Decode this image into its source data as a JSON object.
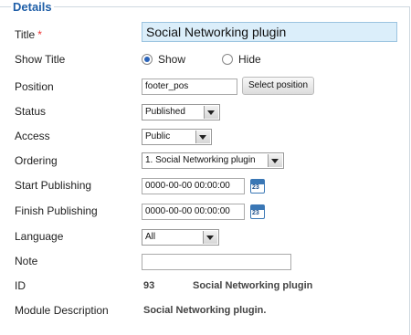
{
  "fieldset": {
    "legend": "Details"
  },
  "title": {
    "label": "Title",
    "required_mark": "*",
    "value": "Social Networking plugin"
  },
  "show_title": {
    "label": "Show Title",
    "options": [
      "Show",
      "Hide"
    ],
    "selected": "Show"
  },
  "position": {
    "label": "Position",
    "value": "footer_pos",
    "button_label": "Select position"
  },
  "status": {
    "label": "Status",
    "value": "Published"
  },
  "access": {
    "label": "Access",
    "value": "Public"
  },
  "ordering": {
    "label": "Ordering",
    "value": "1. Social Networking plugin"
  },
  "start_publishing": {
    "label": "Start Publishing",
    "value": "0000-00-00 00:00:00",
    "calendar_text": "23"
  },
  "finish_publishing": {
    "label": "Finish Publishing",
    "value": "0000-00-00 00:00:00",
    "calendar_text": "23"
  },
  "language": {
    "label": "Language",
    "value": "All"
  },
  "note": {
    "label": "Note",
    "value": ""
  },
  "id": {
    "label": "ID",
    "value": "93",
    "name": "Social Networking plugin"
  },
  "module_description": {
    "label": "Module Description",
    "value": "Social Networking plugin."
  }
}
